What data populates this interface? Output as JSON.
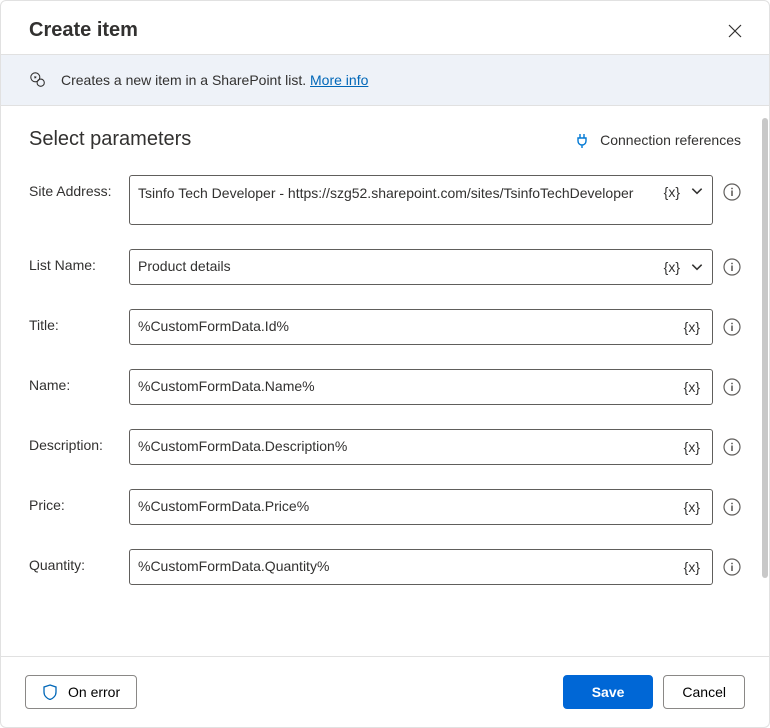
{
  "header": {
    "title": "Create item"
  },
  "banner": {
    "text": "Creates a new item in a SharePoint list.",
    "link": "More info"
  },
  "section": {
    "title": "Select parameters",
    "connection_refs": "Connection references"
  },
  "token_label": "{x}",
  "params": {
    "site_address": {
      "label": "Site Address:",
      "value": "Tsinfo Tech Developer - https://szg52.sharepoint.com/sites/TsinfoTechDeveloper"
    },
    "list_name": {
      "label": "List Name:",
      "value": "Product details"
    },
    "title_f": {
      "label": "Title:",
      "value": "%CustomFormData.Id%"
    },
    "name_f": {
      "label": "Name:",
      "value": "%CustomFormData.Name%"
    },
    "description_f": {
      "label": "Description:",
      "value": "%CustomFormData.Description%"
    },
    "price_f": {
      "label": "Price:",
      "value": "%CustomFormData.Price%"
    },
    "quantity_f": {
      "label": "Quantity:",
      "value": "%CustomFormData.Quantity%"
    }
  },
  "footer": {
    "on_error": "On error",
    "save": "Save",
    "cancel": "Cancel"
  }
}
